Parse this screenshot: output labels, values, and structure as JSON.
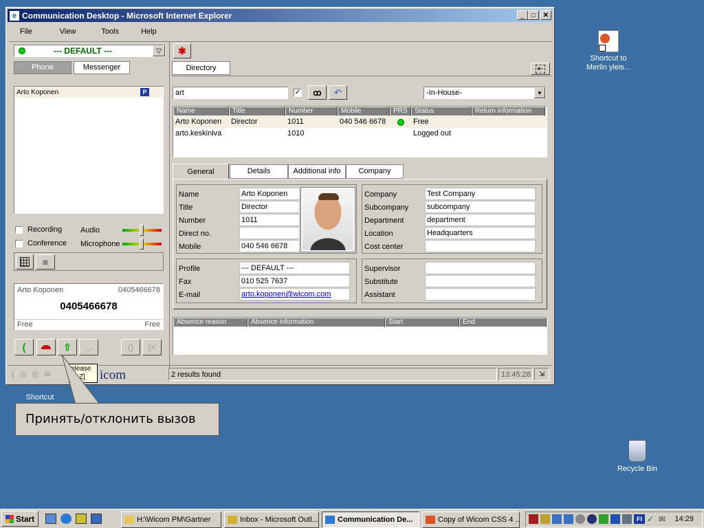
{
  "window": {
    "title": "Communication Desktop - Microsoft Internet Explorer"
  },
  "menu": [
    "File",
    "View",
    "Tools",
    "Help"
  ],
  "profile": {
    "value": "--- DEFAULT ---",
    "status_color": "#00cc00"
  },
  "left_tabs": [
    "Phone",
    "Messenger"
  ],
  "contacts": [
    {
      "name": "Arto Koponen",
      "badge": "P"
    }
  ],
  "recording_label": "Recording",
  "conference_label": "Conference",
  "audio_label": "Audio",
  "microphone_label": "Microphone",
  "call": {
    "name": "Arto Koponen",
    "number_small": "0405466678",
    "number_big": "0405466678",
    "status_left": "Free",
    "status_right": "Free"
  },
  "tooltip": {
    "line1": "elease",
    "line2": "T+Z]"
  },
  "brand": "icom",
  "directory": {
    "tab": "Directory",
    "search_value": "art",
    "filter": "-In-House-",
    "columns": [
      "Name",
      "Title",
      "Number",
      "Mobile",
      "PRS",
      "Status",
      "Return information"
    ],
    "rows": [
      {
        "name": "Arto Koponen",
        "title": "Director",
        "number": "1011",
        "mobile": "040 546 6678",
        "prs": "green",
        "status": "Free",
        "ret": ""
      },
      {
        "name": "arto.keskiniva",
        "title": "",
        "number": "1010",
        "mobile": "",
        "prs": "",
        "status": "Logged out",
        "ret": ""
      }
    ]
  },
  "detail_tabs": [
    "General",
    "Details",
    "Additional info",
    "Company"
  ],
  "general": {
    "name_label": "Name",
    "name": "Arto Koponen",
    "title_label": "Title",
    "title": "Director",
    "number_label": "Number",
    "number": "1011",
    "direct_label": "Direct no.",
    "direct": "",
    "mobile_label": "Mobile",
    "mobile": "040 546 6678",
    "profile_label": "Profile",
    "profile": "--- DEFAULT ---",
    "fax_label": "Fax",
    "fax": "010 525 7637",
    "email_label": "E-mail",
    "email": "arto.koponen@wicom.com"
  },
  "company": {
    "company_label": "Company",
    "company": "Test Company",
    "subcompany_label": "Subcompany",
    "subcompany": "subcompany",
    "department_label": "Department",
    "department": "department",
    "location_label": "Location",
    "location": "Headquarters",
    "cost_label": "Cost center",
    "cost": "",
    "supervisor_label": "Supervisor",
    "supervisor": "",
    "substitute_label": "Substitute",
    "substitute": "",
    "assistant_label": "Assistant",
    "assistant": ""
  },
  "absence_columns": [
    "Absence reason",
    "Absence information",
    "Start",
    "End"
  ],
  "status_bar": {
    "message": "2 results found",
    "time": "13:45:28"
  },
  "callout": "Принять/отклонить вызов",
  "desktop": {
    "shortcut_label": "Shortcut to Merlin yleis...",
    "recycle_label": "Recycle Bin",
    "shortcut2_label": "Shortcut"
  },
  "taskbar": {
    "start": "Start",
    "tasks": [
      "H:\\Wicom PM\\Gartner",
      "Inbox - Microsoft Outl...",
      "Communication De...",
      "Copy of Wicom CSS 4 ..."
    ],
    "clock": "14:29",
    "tray_badge": "FI"
  }
}
